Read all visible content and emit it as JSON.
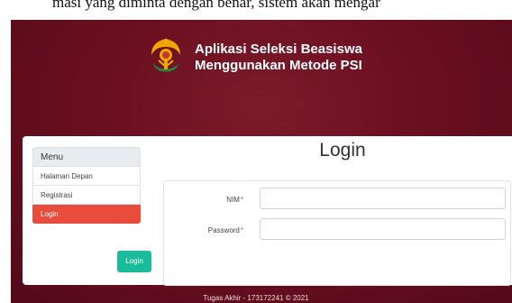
{
  "caption": "masi yang diminta dengan benar, sistem akan mengar",
  "header": {
    "title_line1": "Aplikasi Seleksi Beasiswa",
    "title_line2": "Menggunakan Metode PSI"
  },
  "menu": {
    "heading": "Menu",
    "items": [
      {
        "label": "Halaman Depan",
        "active": false
      },
      {
        "label": "Registrasi",
        "active": false
      },
      {
        "label": "Login",
        "active": true
      }
    ]
  },
  "login": {
    "title": "Login",
    "fields": [
      {
        "label": "NIM",
        "required_mark": "*",
        "value": ""
      },
      {
        "label": "Password",
        "required_mark": "*",
        "value": ""
      }
    ],
    "button_label": "Login"
  },
  "footer": {
    "text": "Tugas Akhir - 173172241 © 2021"
  },
  "colors": {
    "background": "#6a0f20",
    "menu_active": "#e74c3c",
    "button": "#1abc9c",
    "logo_gold": "#f0a500",
    "logo_green": "#1e8a3a",
    "logo_red": "#c0392b"
  }
}
